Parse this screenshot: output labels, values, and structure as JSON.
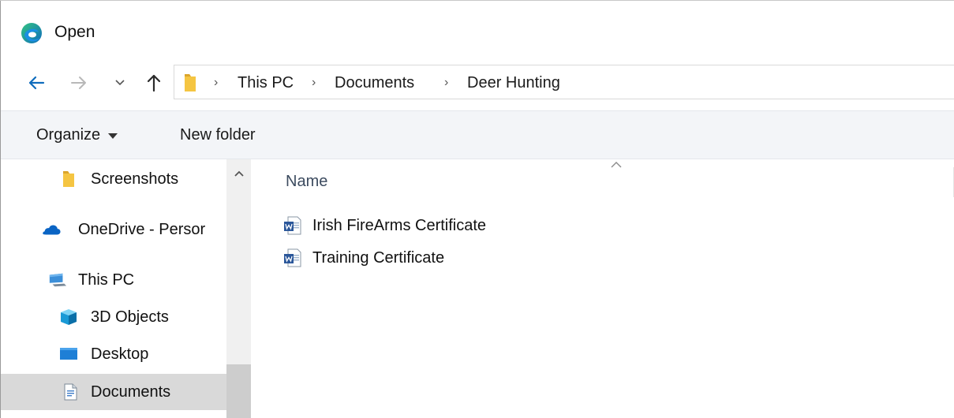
{
  "window": {
    "title": "Open",
    "app_icon": "edge-browser-icon"
  },
  "navigation": {
    "back_icon": "back-arrow-icon",
    "forward_icon": "forward-arrow-icon",
    "recent_icon": "chevron-down-icon",
    "up_icon": "up-arrow-icon"
  },
  "address_bar": {
    "folder_icon": "folder-icon",
    "breadcrumbs": [
      "This PC",
      "Documents",
      "Deer Hunting"
    ],
    "separator": "›"
  },
  "toolbar": {
    "organize_label": "Organize",
    "new_folder_label": "New folder"
  },
  "nav_pane": {
    "items": [
      {
        "label": "Screenshots",
        "icon": "folder-icon"
      },
      {
        "label": "OneDrive - Persor",
        "icon": "onedrive-cloud-icon"
      },
      {
        "label": "This PC",
        "icon": "computer-icon"
      },
      {
        "label": "3D Objects",
        "icon": "3d-objects-icon"
      },
      {
        "label": "Desktop",
        "icon": "desktop-icon"
      },
      {
        "label": "Documents",
        "icon": "documents-icon",
        "selected": true
      }
    ]
  },
  "file_list": {
    "column_name": "Name",
    "files": [
      {
        "name": "Irish FireArms Certificate",
        "icon": "word-document-icon"
      },
      {
        "name": "Training Certificate",
        "icon": "word-document-icon"
      }
    ]
  },
  "colors": {
    "accent_blue": "#0078d4",
    "folder_yellow": "#f5c542",
    "toolbar_bg": "#f3f5f8",
    "selected_bg": "#d9d9d9",
    "word_blue": "#2b579a"
  }
}
